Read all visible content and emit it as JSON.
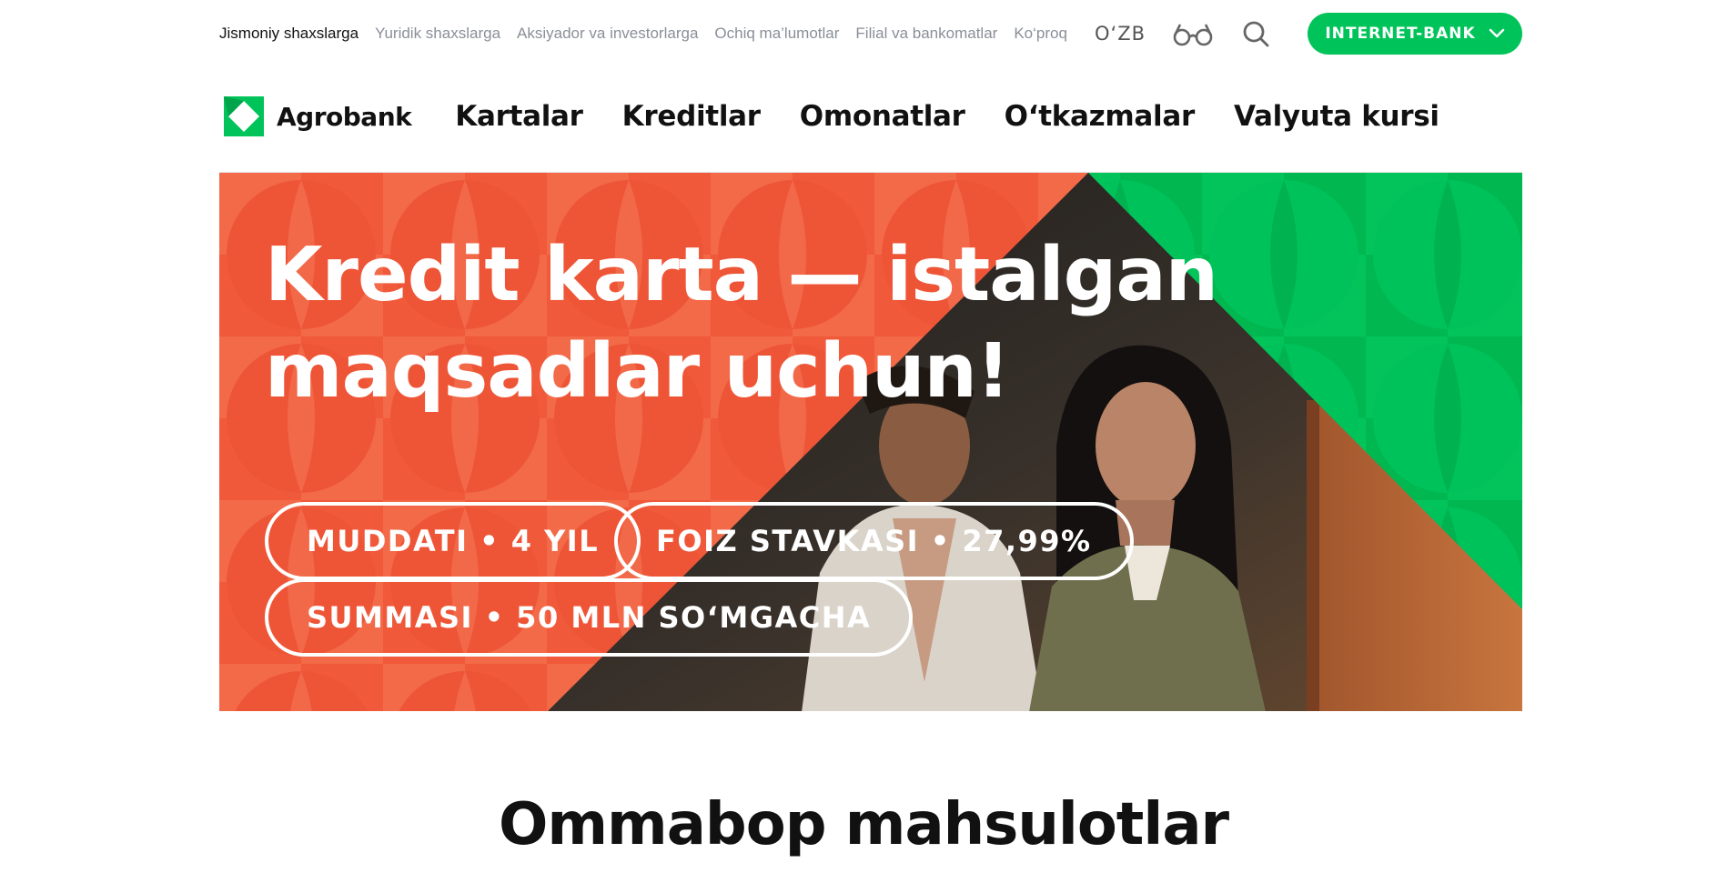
{
  "topbar": {
    "segments": [
      {
        "label": "Jismoniy shaxslarga",
        "active": true
      },
      {
        "label": "Yuridik shaxslarga",
        "active": false
      },
      {
        "label": "Aksiyador va investorlarga",
        "active": false
      },
      {
        "label": "Ochiq ma’lumotlar",
        "active": false
      },
      {
        "label": "Filial va bankomatlar",
        "active": false
      },
      {
        "label": "Ko‘proq",
        "active": false
      }
    ],
    "language": "O‘ZB",
    "accessibility_icon": "glasses-icon",
    "search_icon": "search-icon",
    "internet_bank_label": "INTERNET-BANK"
  },
  "header": {
    "logo_text": "Agrobank",
    "nav": [
      "Kartalar",
      "Kreditlar",
      "Omonatlar",
      "O‘tkazmalar",
      "Valyuta kursi"
    ]
  },
  "hero": {
    "title_line1": "Kredit karta — istalgan",
    "title_line2": "maqsadlar uchun!",
    "pills": [
      "MUDDATI • 4 YIL",
      "FOIZ STAVKASI • 27,99%",
      "SUMMASI • 50 MLN SO‘MGACHA"
    ]
  },
  "section": {
    "title": "Ommabop mahsulotlar"
  },
  "colors": {
    "brand_green": "#00c45a",
    "hero_orange": "#f05a3a",
    "hero_green": "#00b84f"
  }
}
